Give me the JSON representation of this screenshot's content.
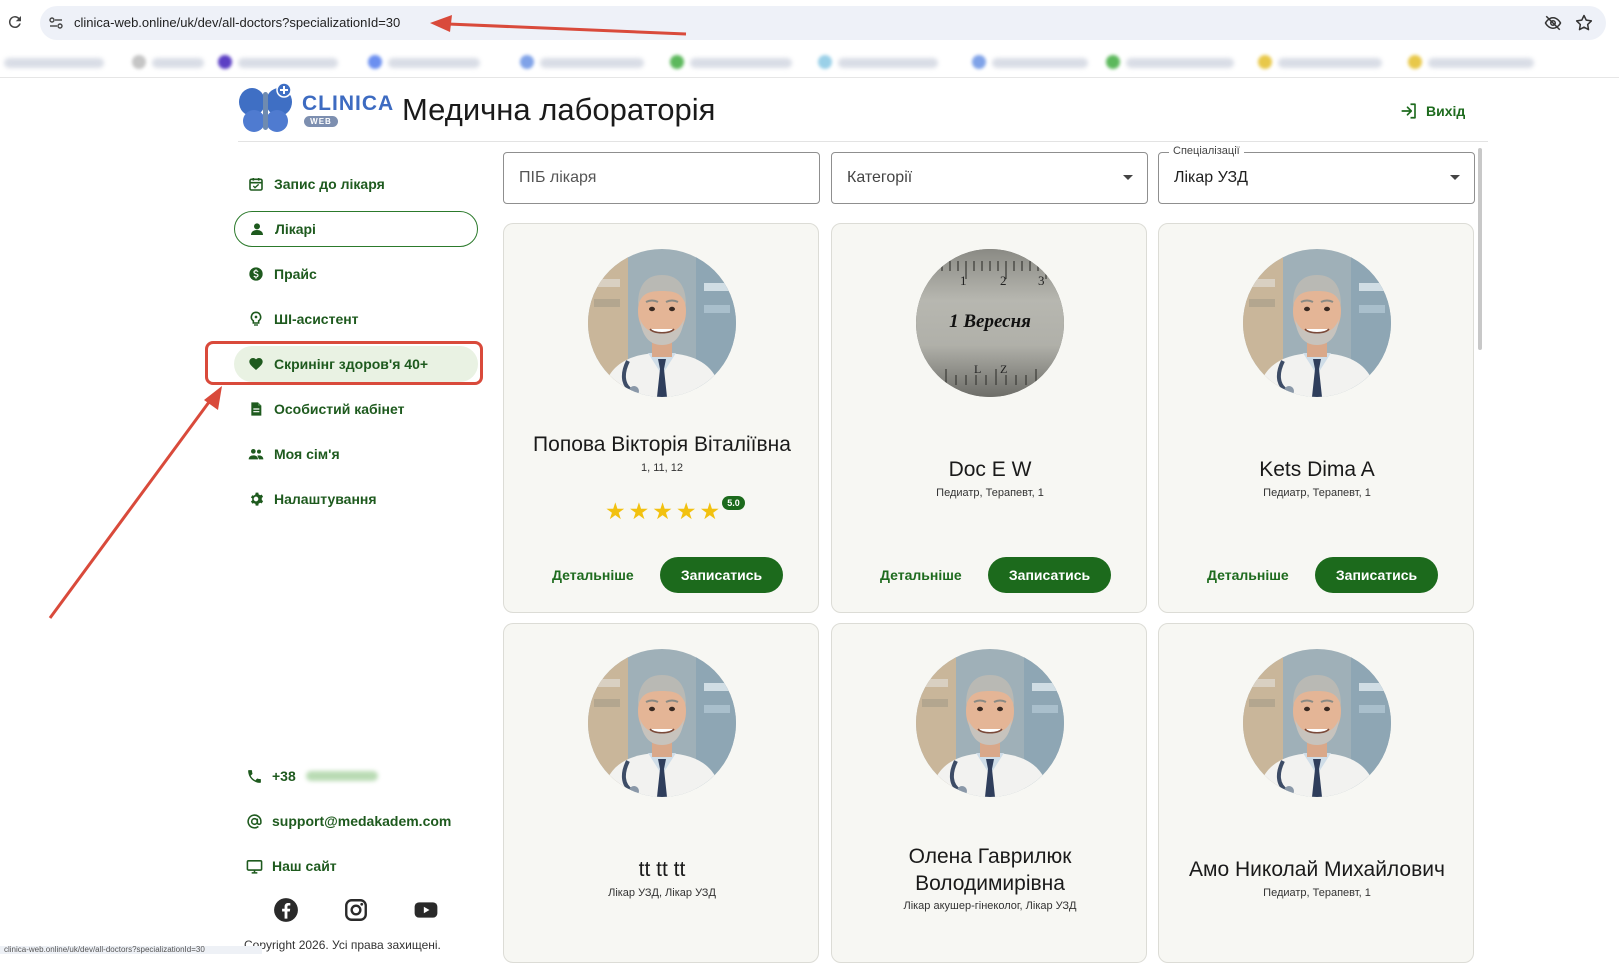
{
  "browser": {
    "url": "clinica-web.online/uk/dev/all-doctors?specializationId=30",
    "status_url": "clinica-web.online/uk/dev/all-doctors?specializationId=30"
  },
  "header": {
    "logo_word": "CLINICA",
    "logo_sub": "WEB",
    "title": "Медична лабораторія",
    "logout_label": "Вихід"
  },
  "sidebar": {
    "items": [
      {
        "label": "Запис до лікаря",
        "icon": "calendar-icon"
      },
      {
        "label": "Лікарі",
        "icon": "person-icon"
      },
      {
        "label": "Прайс",
        "icon": "dollar-icon"
      },
      {
        "label": "ШІ-асистент",
        "icon": "lightbulb-icon"
      },
      {
        "label": "Скринінг здоров'я 40+",
        "icon": "heart-icon"
      },
      {
        "label": "Особистий кабінет",
        "icon": "document-icon"
      },
      {
        "label": "Моя сім'я",
        "icon": "group-icon"
      },
      {
        "label": "Налаштування",
        "icon": "gear-icon"
      }
    ],
    "active_index": 1,
    "contacts": {
      "phone_prefix": "+38",
      "email": "support@medakadem.com",
      "site_label": "Наш сайт"
    },
    "copyright": "Copyright 2026. Усі права захищені."
  },
  "filters": {
    "name_placeholder": "ПІБ лікаря",
    "category_placeholder": "Категорії",
    "specialization_legend": "Спеціалізації",
    "specialization_value": "Лікар УЗД"
  },
  "cards": [
    {
      "name": "Попова Вікторія Віталіївна",
      "spec": "1, 11, 12",
      "rating": "5.0",
      "stars": 5,
      "photo": "doctor",
      "details": "Детальніше",
      "book": "Записатись"
    },
    {
      "name": "Doc E W",
      "spec": "Педиатр, Терапевт, 1",
      "photo": "ruler",
      "photo_text": "1 Вересня",
      "details": "Детальніше",
      "book": "Записатись"
    },
    {
      "name": "Kets Dima A",
      "spec": "Педиатр, Терапевт, 1",
      "photo": "doctor",
      "details": "Детальніше",
      "book": "Записатись"
    },
    {
      "name": "tt tt tt",
      "spec": "Лікар УЗД, Лікар УЗД",
      "photo": "doctor"
    },
    {
      "name": "Олена Гаврилюк Володимирівна",
      "spec": "Лікар акушер-гінеколог, Лікар УЗД",
      "photo": "doctor"
    },
    {
      "name": "Амо Николай Михайлович",
      "spec": "Педиатр, Терапевт, 1",
      "photo": "doctor"
    }
  ],
  "colors": {
    "primary_green": "#1c6a1c",
    "nav_text": "#1e5a1e",
    "annotation_red": "#d94a3b",
    "logo_blue": "#3d6bc1"
  }
}
